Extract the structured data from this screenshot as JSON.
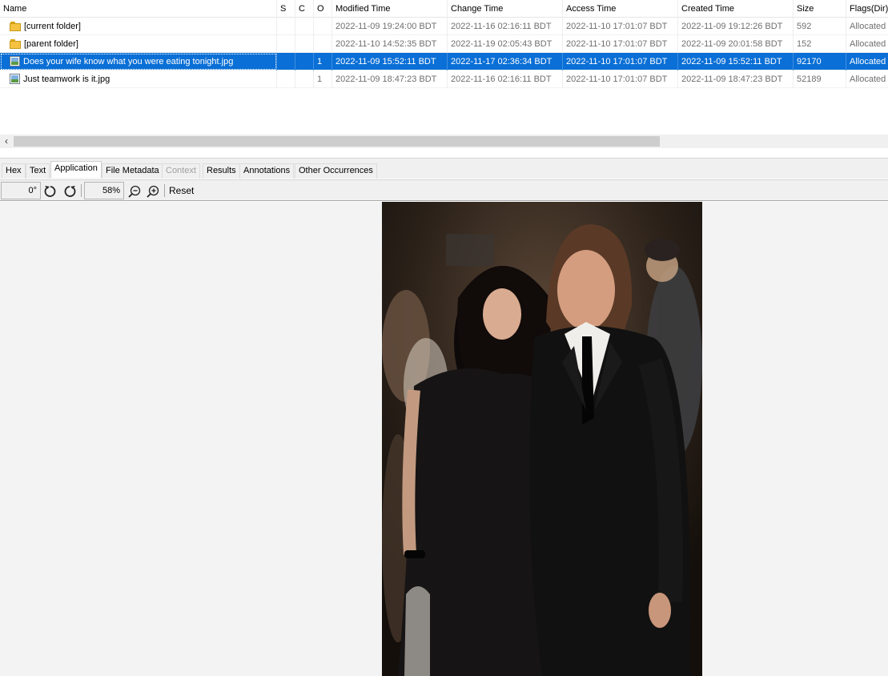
{
  "table": {
    "columns": [
      "Name",
      "S",
      "C",
      "O",
      "Modified Time",
      "Change Time",
      "Access Time",
      "Created Time",
      "Size",
      "Flags(Dir)"
    ],
    "rows": [
      {
        "name": "[current folder]",
        "icon": "folder-icon",
        "s": "",
        "c": "",
        "o": "",
        "modified": "2022-11-09 19:24:00 BDT",
        "changed": "2022-11-16 02:16:11 BDT",
        "accessed": "2022-11-10 17:01:07 BDT",
        "created": "2022-11-09 19:12:26 BDT",
        "size": "592",
        "flags": "Allocated"
      },
      {
        "name": "[parent folder]",
        "icon": "folder-icon",
        "s": "",
        "c": "",
        "o": "",
        "modified": "2022-11-10 14:52:35 BDT",
        "changed": "2022-11-19 02:05:43 BDT",
        "accessed": "2022-11-10 17:01:07 BDT",
        "created": "2022-11-09 20:01:58 BDT",
        "size": "152",
        "flags": "Allocated"
      },
      {
        "name": "Does your wife know what you were eating tonight.jpg",
        "icon": "image-file-icon",
        "s": "",
        "c": "",
        "o": "1",
        "modified": "2022-11-09 15:52:11 BDT",
        "changed": "2022-11-17 02:36:34 BDT",
        "accessed": "2022-11-10 17:01:07 BDT",
        "created": "2022-11-09 15:52:11 BDT",
        "size": "92170",
        "flags": "Allocated",
        "selected": true
      },
      {
        "name": "Just teamwork is it.jpg",
        "icon": "image-file-icon",
        "s": "",
        "c": "",
        "o": "1",
        "modified": "2022-11-09 18:47:23 BDT",
        "changed": "2022-11-16 02:16:11 BDT",
        "accessed": "2022-11-10 17:01:07 BDT",
        "created": "2022-11-09 18:47:23 BDT",
        "size": "52189",
        "flags": "Allocated"
      }
    ]
  },
  "tabs": [
    {
      "label": "Hex",
      "state": "normal"
    },
    {
      "label": "Text",
      "state": "normal"
    },
    {
      "label": "Application",
      "state": "active"
    },
    {
      "label": "File Metadata",
      "state": "normal"
    },
    {
      "label": "Context",
      "state": "disabled"
    },
    {
      "label": "Results",
      "state": "normal"
    },
    {
      "label": "Annotations",
      "state": "normal"
    },
    {
      "label": "Other Occurrences",
      "state": "normal"
    }
  ],
  "toolbar": {
    "rotation": "0°",
    "zoom": "58%",
    "reset_label": "Reset",
    "icons": [
      "rotate-left-icon",
      "rotate-right-icon",
      "zoom-out-icon",
      "zoom-in-icon"
    ]
  },
  "colors": {
    "selection": "#0a6fd6",
    "viewer_background": "#f3f3f3"
  }
}
